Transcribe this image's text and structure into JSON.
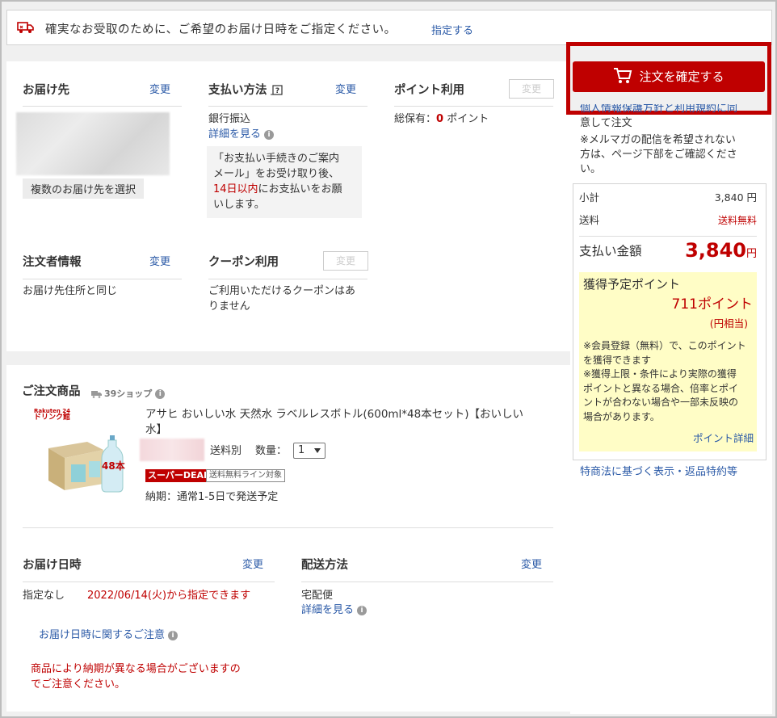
{
  "banner": {
    "message": "確実なお受取のために、ご希望のお届け日時をご指定ください。",
    "link": "指定する"
  },
  "delivery_address": {
    "title": "お届け先",
    "change": "変更",
    "multi_button": "複数のお届け先を選択"
  },
  "payment": {
    "title": "支払い方法",
    "change": "変更",
    "method": "銀行振込",
    "details_link": "詳細を見る",
    "note_line1": "「お支払い手続きのご案内",
    "note_line2": "メール」をお受け取り後、",
    "note_red": "14日以内",
    "note_line3_rest": "にお支払いをお願",
    "note_line4": "いします。"
  },
  "points": {
    "title": "ポイント利用",
    "change": "変更",
    "total_label": "総保有：",
    "total_value": "0",
    "total_unit": "ポイント"
  },
  "orderer": {
    "title": "注文者情報",
    "change": "変更",
    "value": "お届け先住所と同じ"
  },
  "coupon": {
    "title": "クーポン利用",
    "change": "変更",
    "line1": "ご利用いただけるクーポンはあ",
    "line2": "りません"
  },
  "products": {
    "title": "ご注文商品",
    "shop": "39ショップ",
    "image_brand_line1": "Rakuten 24",
    "image_brand_line2": "ドリンク館",
    "image_label": "48本",
    "name_line1": "アサヒ おいしい水 天然水 ラベルレスボトル(600ml*48本セット)【おいしい",
    "name_line2": "水】",
    "shipping": "送料別",
    "qty_label": "数量：",
    "qty_value": "1",
    "deal_badge": "スーパーDEAL",
    "free_line_badge": "送料無料ライン対象",
    "delivery_term": "納期：通常1-5日で発送予定"
  },
  "delivery_date": {
    "title": "お届け日時",
    "change": "変更",
    "label": "指定なし",
    "value": "2022/06/14(火)から指定できます",
    "notes_link": "お届け日時に関するご注意",
    "warning_line1": "商品により納期が異なる場合がございますの",
    "warning_line2": "でご注意ください。"
  },
  "shipping_method": {
    "title": "配送方法",
    "change": "変更",
    "value": "宅配便",
    "details_link": "詳細を見る"
  },
  "sidebar": {
    "order_button": "注文を確定する",
    "agree_link": "個人情報保護方針と利用規約に同",
    "agree_rest": "意して注文",
    "newsletter_line1": "※メルマガの配信を希望されない",
    "newsletter_line2": "方は、ページ下部をご確認くださ",
    "newsletter_line3": "い。",
    "subtotal_label": "小計",
    "subtotal_value": "3,840 円",
    "shipping_label": "送料",
    "shipping_value": "送料無料",
    "total_label": "支払い金額",
    "total_value": "3,840",
    "total_unit": "円",
    "earn_title": "獲得予定ポイント",
    "earn_value": "711ポイント",
    "earn_sub": "(円相当)",
    "earn_note1_l1": "※会員登録（無料）で、このポイント",
    "earn_note1_l2": "を獲得できます",
    "earn_note2_l1": "※獲得上限・条件により実際の獲得",
    "earn_note2_l2": "ポイントと異なる場合、倍率とポイ",
    "earn_note2_l3": "ントが合わない場合や一部未反映の",
    "earn_note2_l4": "場合があります。",
    "earn_link": "ポイント詳細",
    "law_link": "特商法に基づく表示・返品特約等"
  },
  "colors": {
    "accent_red": "#bf0000",
    "link_blue": "#2b5aa7",
    "point_box": "#fffdc6"
  }
}
